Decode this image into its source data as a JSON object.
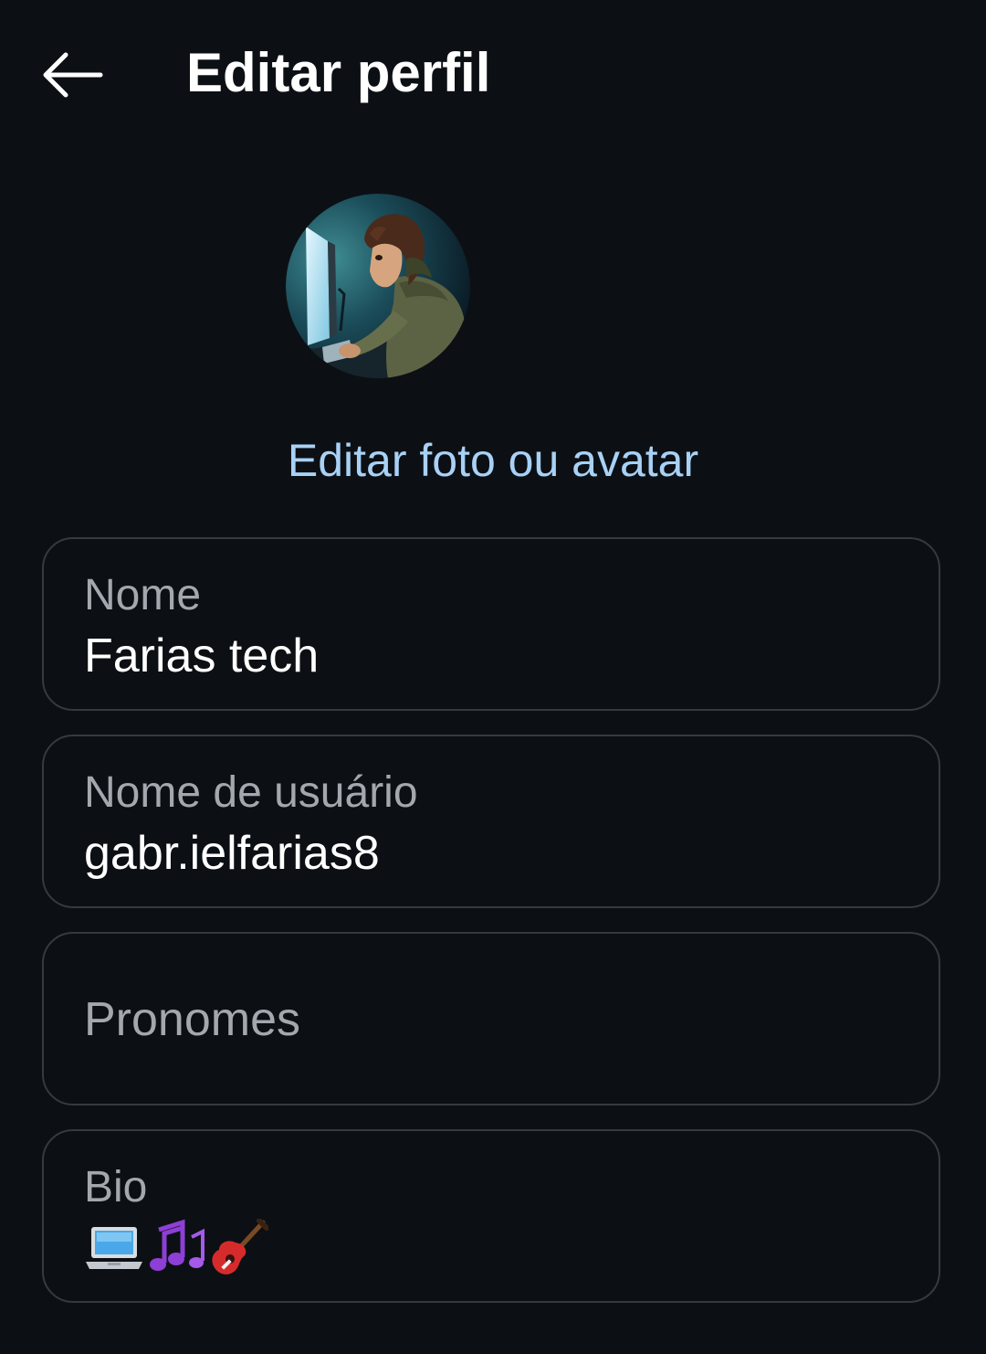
{
  "header": {
    "back_icon": "arrow-left-icon",
    "title": "Editar perfil"
  },
  "profile": {
    "avatar_alt": "person-at-computer-illustration",
    "edit_photo_label": "Editar foto ou avatar"
  },
  "fields": {
    "name": {
      "label": "Nome",
      "value": "Farias tech"
    },
    "username": {
      "label": "Nome de usuário",
      "value": "gabr.ielfarias8"
    },
    "pronouns": {
      "placeholder": "Pronomes",
      "value": ""
    },
    "bio": {
      "label": "Bio",
      "emojis": [
        "laptop-emoji",
        "musical-notes-emoji",
        "guitar-emoji"
      ]
    }
  },
  "colors": {
    "background": "#0c1014",
    "link": "#a8d1f6",
    "field_border": "#363a40",
    "label": "#a4a8ae",
    "text": "#ffffff"
  }
}
